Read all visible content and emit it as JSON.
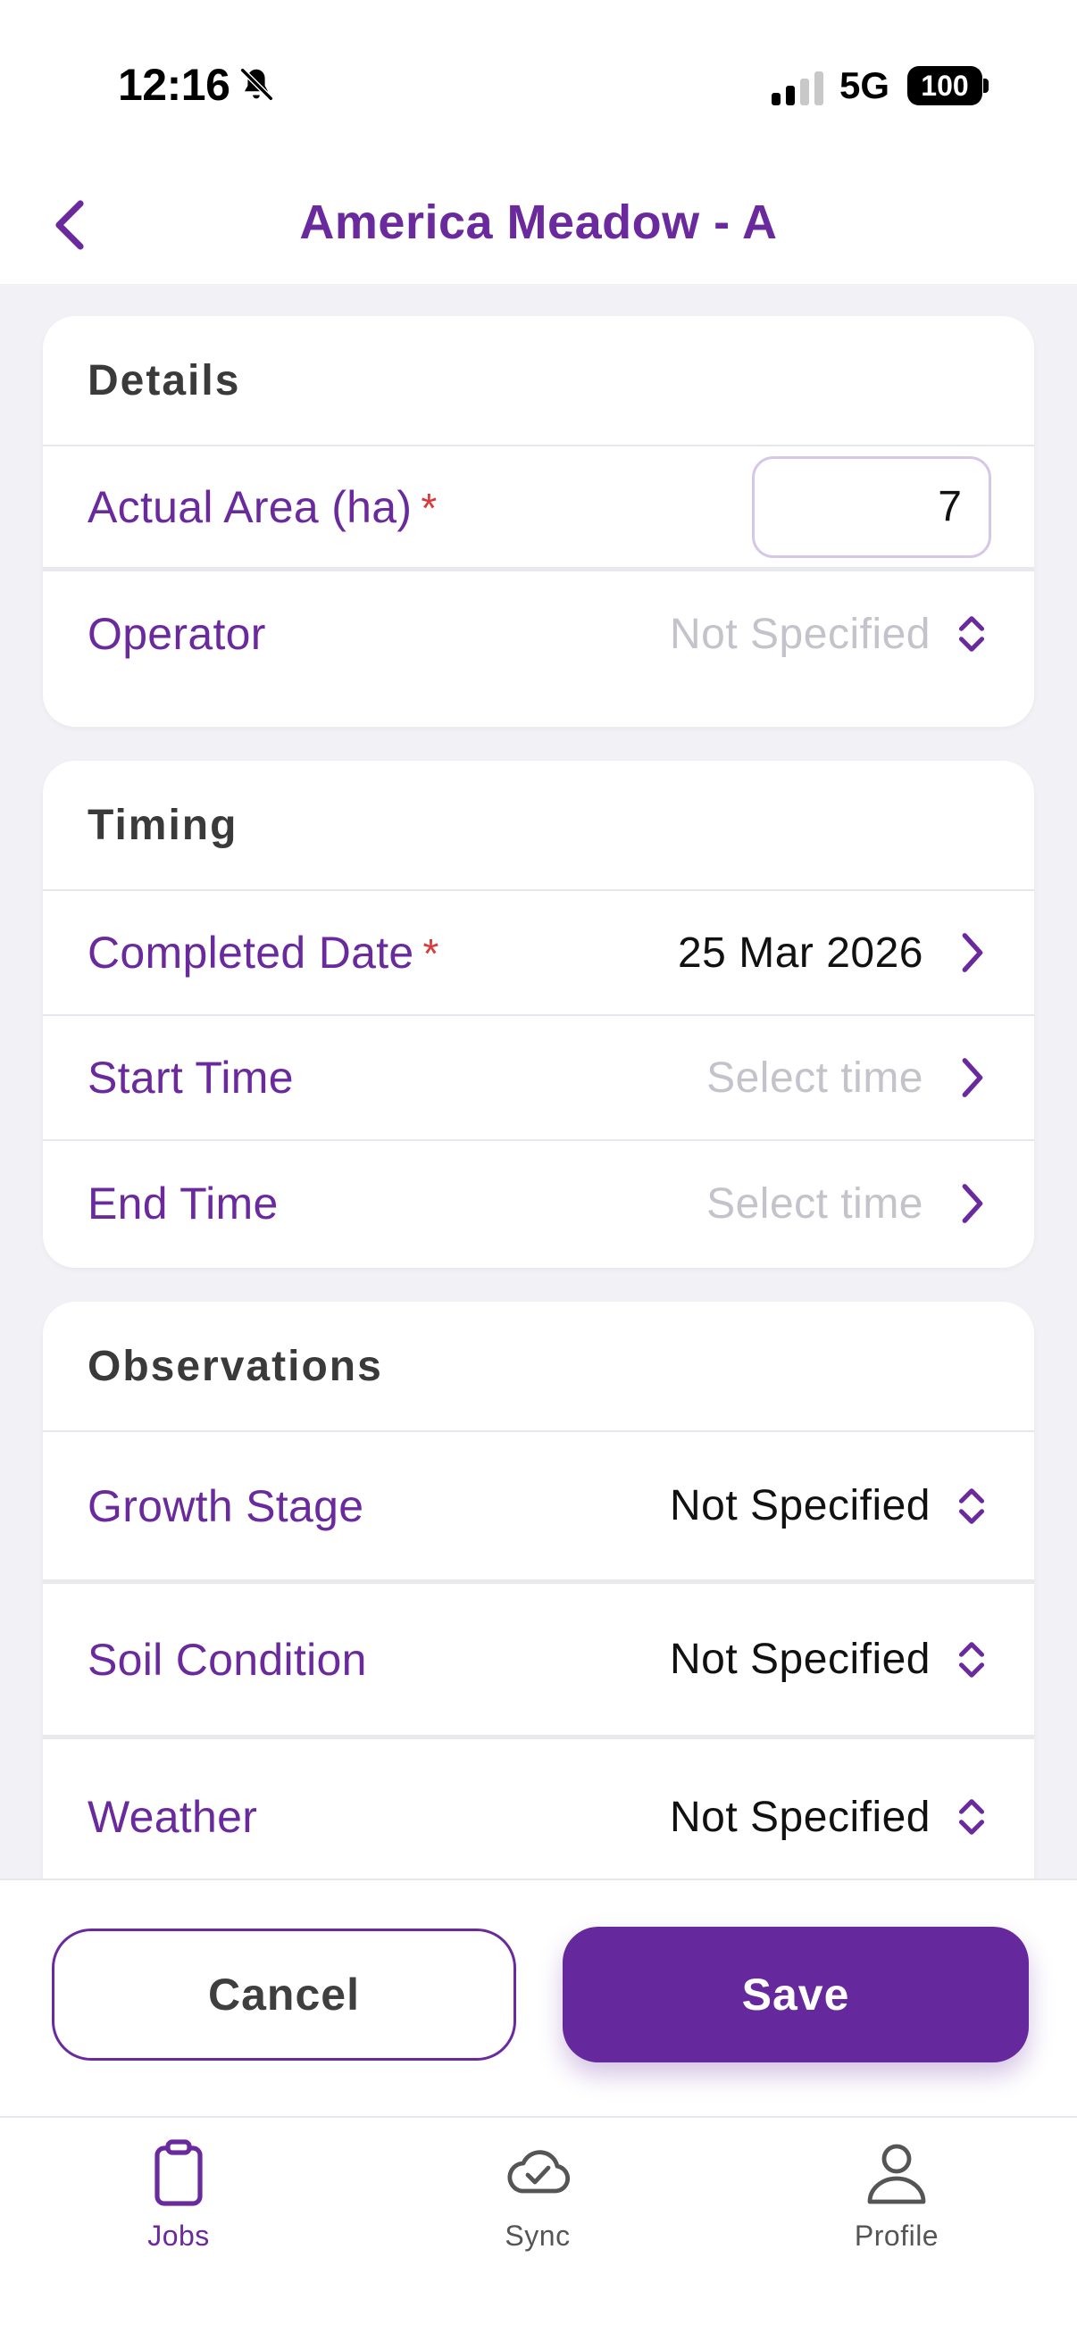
{
  "status_bar": {
    "time": "12:16",
    "network": "5G",
    "battery": "100"
  },
  "header": {
    "title": "America Meadow - A"
  },
  "details": {
    "title": "Details",
    "actual_area": {
      "label": "Actual Area (ha)",
      "required": "*",
      "value": "7"
    },
    "operator": {
      "label": "Operator",
      "value": "Not Specified"
    }
  },
  "timing": {
    "title": "Timing",
    "completed_date": {
      "label": "Completed Date",
      "required": "*",
      "value": "25 Mar 2026"
    },
    "start_time": {
      "label": "Start Time",
      "value": "Select time"
    },
    "end_time": {
      "label": "End Time",
      "value": "Select time"
    }
  },
  "observations": {
    "title": "Observations",
    "growth_stage": {
      "label": "Growth Stage",
      "value": "Not Specified"
    },
    "soil_condition": {
      "label": "Soil Condition",
      "value": "Not Specified"
    },
    "weather": {
      "label": "Weather",
      "value": "Not Specified"
    }
  },
  "actions": {
    "cancel_label": "Cancel",
    "save_label": "Save"
  },
  "tabs": [
    {
      "label": "Jobs",
      "icon": "clipboard-icon",
      "active": true
    },
    {
      "label": "Sync",
      "icon": "cloud-check-icon",
      "active": false
    },
    {
      "label": "Profile",
      "icon": "person-icon",
      "active": false
    }
  ],
  "colors": {
    "accent": "#6a2a9e",
    "required": "#d93a3a",
    "background": "#f1f1f6"
  }
}
